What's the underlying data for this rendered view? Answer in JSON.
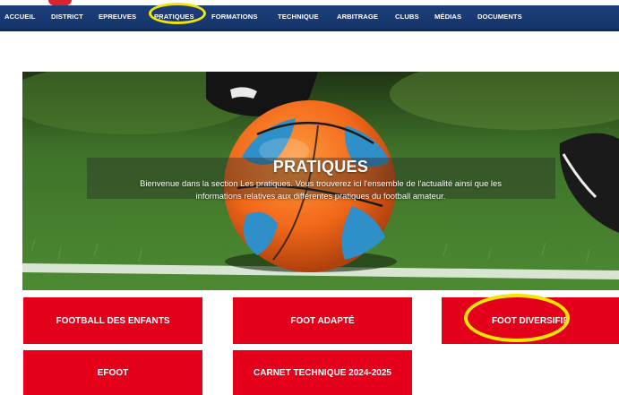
{
  "nav": {
    "items": [
      {
        "label": "ACCUEIL"
      },
      {
        "label": "DISTRICT"
      },
      {
        "label": "EPREUVES"
      },
      {
        "label": "PRATIQUES"
      },
      {
        "label": "FORMATIONS"
      },
      {
        "label": "TECHNIQUE"
      },
      {
        "label": "ARBITRAGE"
      },
      {
        "label": "CLUBS"
      },
      {
        "label": "MÉDIAS"
      },
      {
        "label": "DOCUMENTS"
      }
    ],
    "bg_color": "#1d3f7a",
    "highlight_color": "#f2e600"
  },
  "hero": {
    "title": "PRATIQUES",
    "line1": "Bienvenue dans la section Les pratiques. Vous trouverez ici l'ensemble de l'actualité ainsi que les",
    "line2": "informations relatives aux différentes pratiques du football amateur."
  },
  "tiles": [
    {
      "label": "FOOTBALL DES ENFANTS"
    },
    {
      "label": "FOOT ADAPTÉ"
    },
    {
      "label": "FOOT DIVERSIFIÉ"
    },
    {
      "label": "EFOOT"
    },
    {
      "label": "CARNET TECHNIQUE 2024-2025"
    }
  ],
  "colors": {
    "tile_red": "#e4001b",
    "annotation_yellow": "#f2e600"
  }
}
